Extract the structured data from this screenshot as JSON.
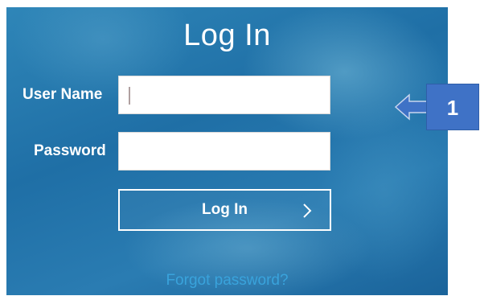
{
  "login": {
    "title": "Log In",
    "username_label": "User Name",
    "username_value": "",
    "password_label": "Password",
    "password_value": "",
    "submit_label": "Log In",
    "submit_icon": "chevron-right-icon",
    "forgot_link": "Forgot password?"
  },
  "annotation": {
    "number": "1",
    "arrow_icon": "left-arrow-icon"
  },
  "colors": {
    "panel_blue": "#1f6fa6",
    "link_blue": "#39a3dc",
    "callout_blue": "#3f72c6",
    "white": "#ffffff"
  }
}
